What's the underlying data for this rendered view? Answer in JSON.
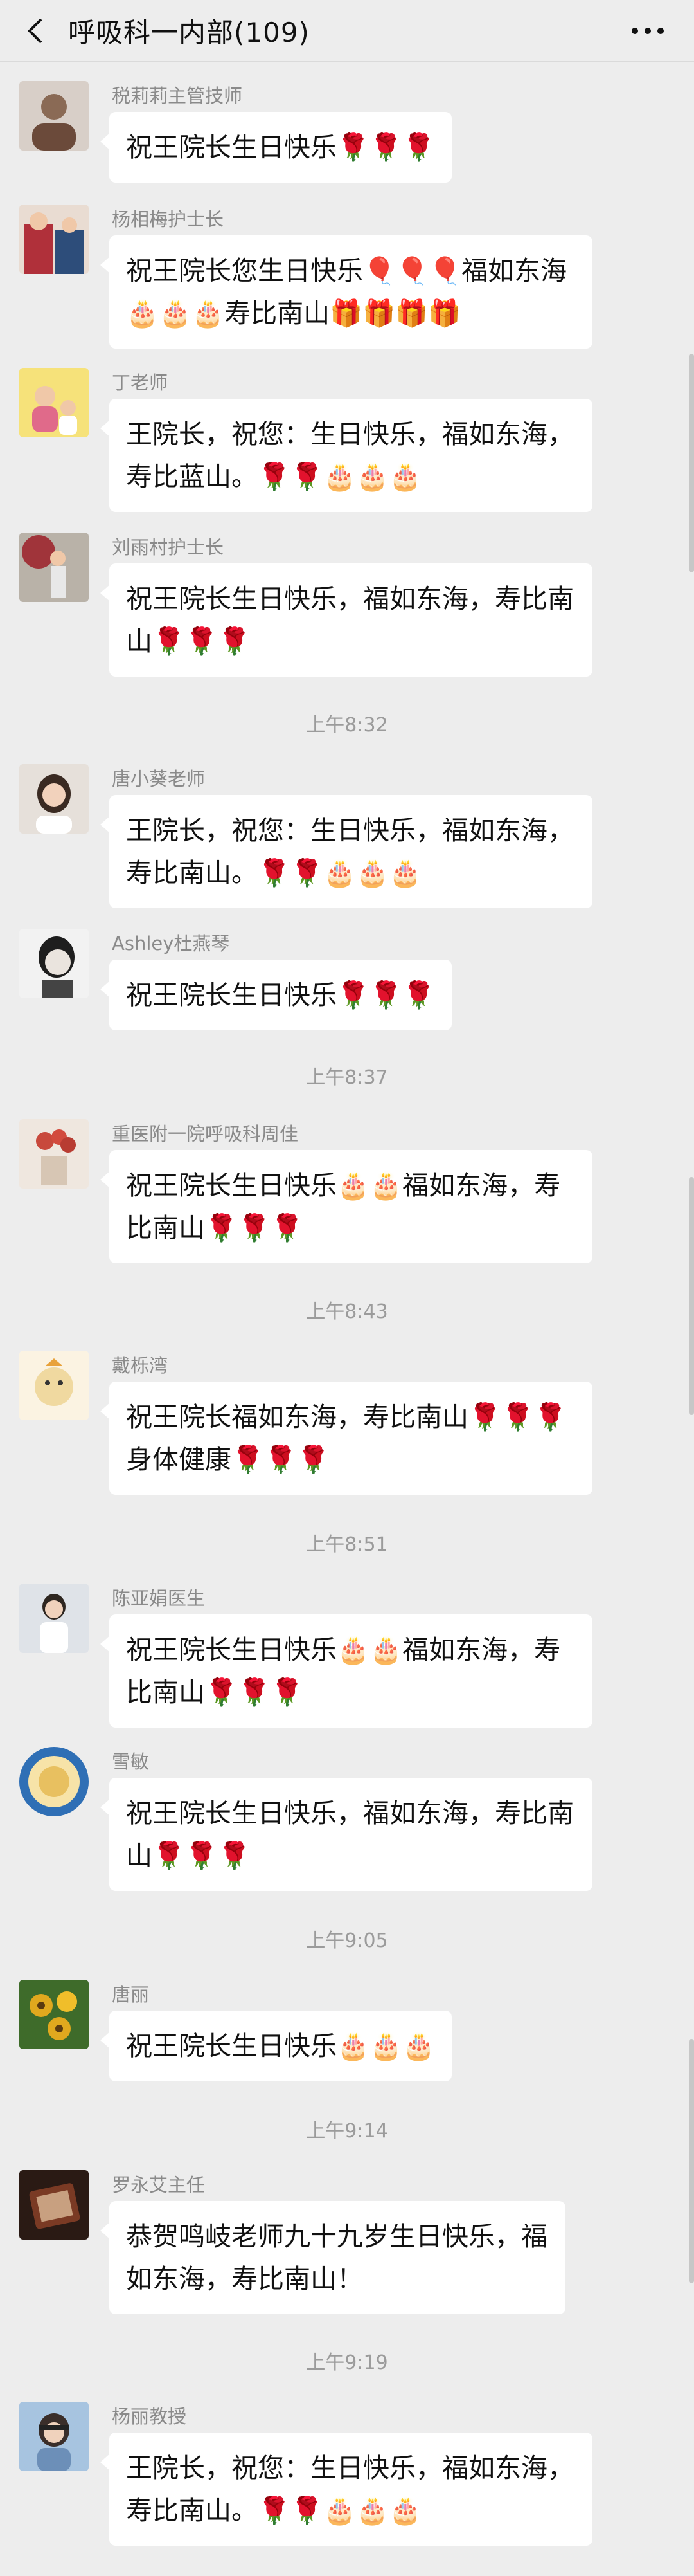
{
  "header": {
    "title": "呼吸科一内部(109)",
    "back_icon": "chevron-left-icon",
    "more_icon": "more-horizontal-icon"
  },
  "messages": [
    {
      "sender": "税莉莉主管技师",
      "text": "祝王院长生日快乐🌹🌹🌹",
      "avatar_color": "#8a6a55"
    },
    {
      "sender": "杨相梅护士长",
      "text": "祝王院长您生日快乐🎈🎈🎈福如东海🎂🎂🎂寿比南山🎁🎁🎁🎁",
      "avatar_color": "#b0303a"
    },
    {
      "sender": "丁老师",
      "text": "王院长，祝您：生日快乐，福如东海，寿比蓝山。🌹🌹🎂🎂🎂",
      "avatar_color": "#e8c23a"
    },
    {
      "sender": "刘雨村护士长",
      "text": "祝王院长生日快乐，福如东海，寿比南山🌹🌹🌹",
      "avatar_color": "#7a6a5a"
    },
    {
      "sender": "唐小葵老师",
      "text": "王院长，祝您：生日快乐，福如东海，寿比南山。🌹🌹🎂🎂🎂",
      "avatar_color": "#c9b7a8"
    },
    {
      "sender": "Ashley杜燕琴",
      "text": "祝王院长生日快乐🌹🌹🌹",
      "avatar_color": "#d9d9d9"
    },
    {
      "sender": "重医附一院呼吸科周佳",
      "text": "祝王院长生日快乐🎂🎂福如东海，寿比南山🌹🌹🌹",
      "avatar_color": "#c8493c"
    },
    {
      "sender": "戴栎湾",
      "text": "祝王院长福如东海，寿比南山🌹🌹🌹身体健康🌹🌹🌹",
      "avatar_color": "#f0d9a0"
    },
    {
      "sender": "陈亚娟医生",
      "text": "祝王院长生日快乐🎂🎂福如东海，寿比南山🌹🌹🌹",
      "avatar_color": "#cfd6de"
    },
    {
      "sender": "雪敏",
      "text": "祝王院长生日快乐，福如东海，寿比南山🌹🌹🌹",
      "avatar_color": "#2f6fb5"
    },
    {
      "sender": "唐丽",
      "text": "祝王院长生日快乐🎂🎂🎂",
      "avatar_color": "#e0a81e"
    },
    {
      "sender": "罗永艾主任",
      "text": "恭贺鸣岐老师九十九岁生日快乐，福如东海，寿比南山！",
      "avatar_color": "#5a3020"
    },
    {
      "sender": "杨丽教授",
      "text": "王院长，祝您：生日快乐，福如东海，寿比南山。🌹🌹🎂🎂🎂",
      "avatar_color": "#6c8fb8"
    }
  ],
  "times": [
    "上午8:32",
    "上午8:37",
    "上午8:43",
    "上午8:51",
    "上午9:05",
    "上午9:14",
    "上午9:19"
  ]
}
